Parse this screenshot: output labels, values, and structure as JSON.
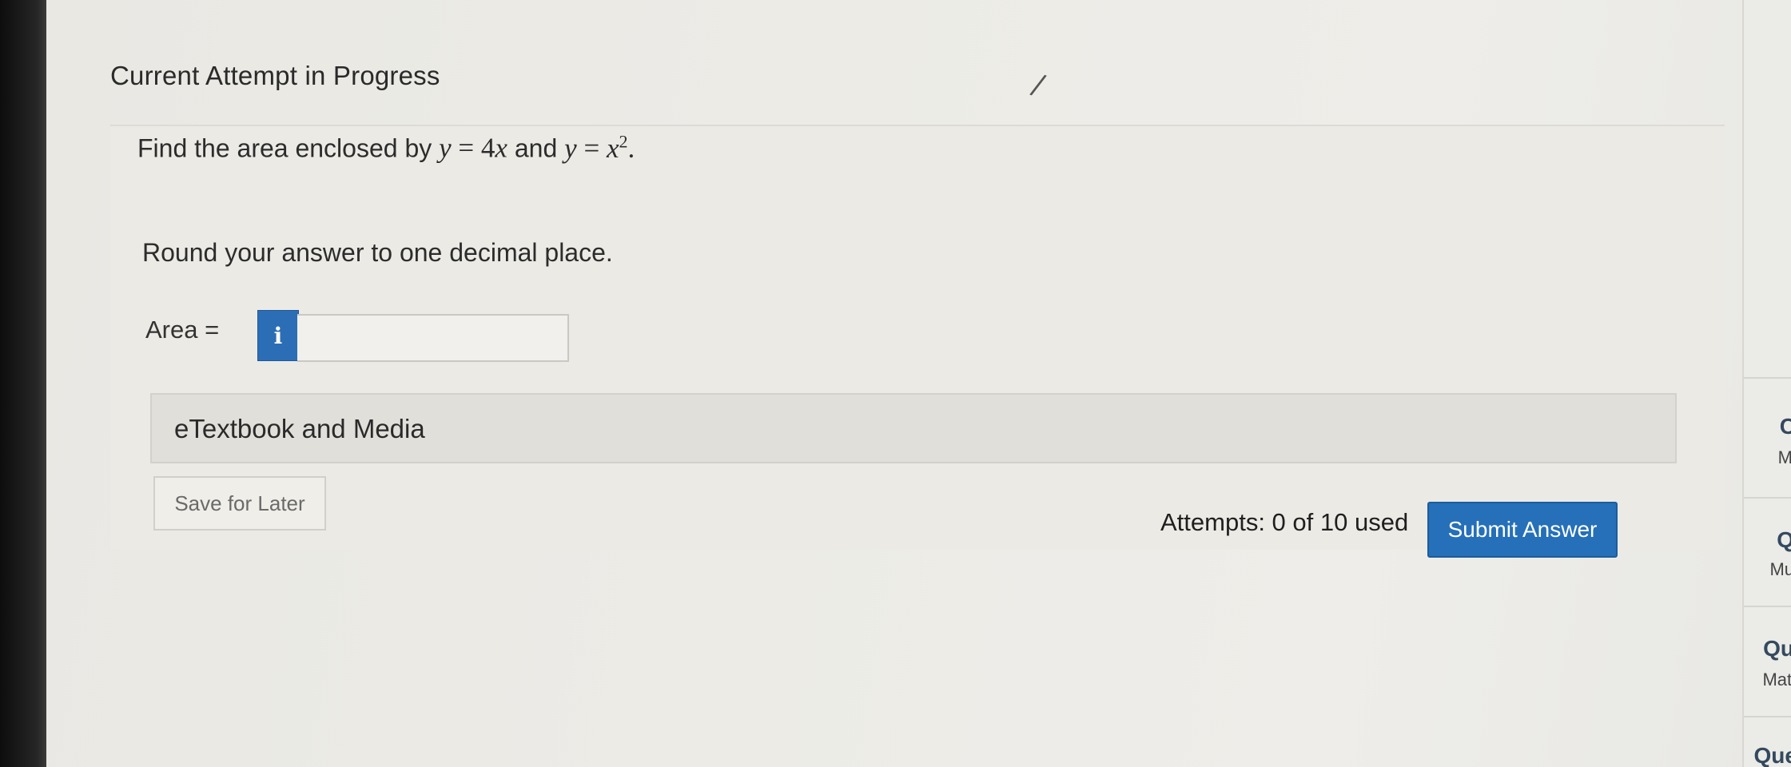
{
  "header": {
    "title": "Current Attempt in Progress"
  },
  "question": {
    "prompt_prefix": "Find the area enclosed by ",
    "eq1_lhs": "y",
    "eq1_rhs_coef": "4",
    "eq1_rhs_var": "x",
    "connector": " and ",
    "eq2_lhs": "y",
    "eq2_rhs_var": "x",
    "eq2_exponent": "2",
    "equals": "=",
    "period": ".",
    "instruction": "Round your answer to one decimal place."
  },
  "answer": {
    "label": "Area  =",
    "info_glyph": "i",
    "value": "",
    "placeholder": ""
  },
  "etextbook": {
    "label": "eTextbook and Media"
  },
  "footer": {
    "save_label": "Save for Later",
    "attempts_text": "Attempts: 0 of 10 used",
    "submit_label": "Submit Answer"
  },
  "side_panel": {
    "items": [
      {
        "title": "C",
        "sub": "M"
      },
      {
        "title": "Q",
        "sub": "Mu"
      },
      {
        "title": "Qu",
        "sub": "Matl"
      },
      {
        "title": "Que",
        "sub": ""
      }
    ]
  },
  "colors": {
    "accent_blue": "#2570b8",
    "info_blue": "#2c6eb5",
    "background": "#ecebe6",
    "text": "#2c2c2c"
  }
}
